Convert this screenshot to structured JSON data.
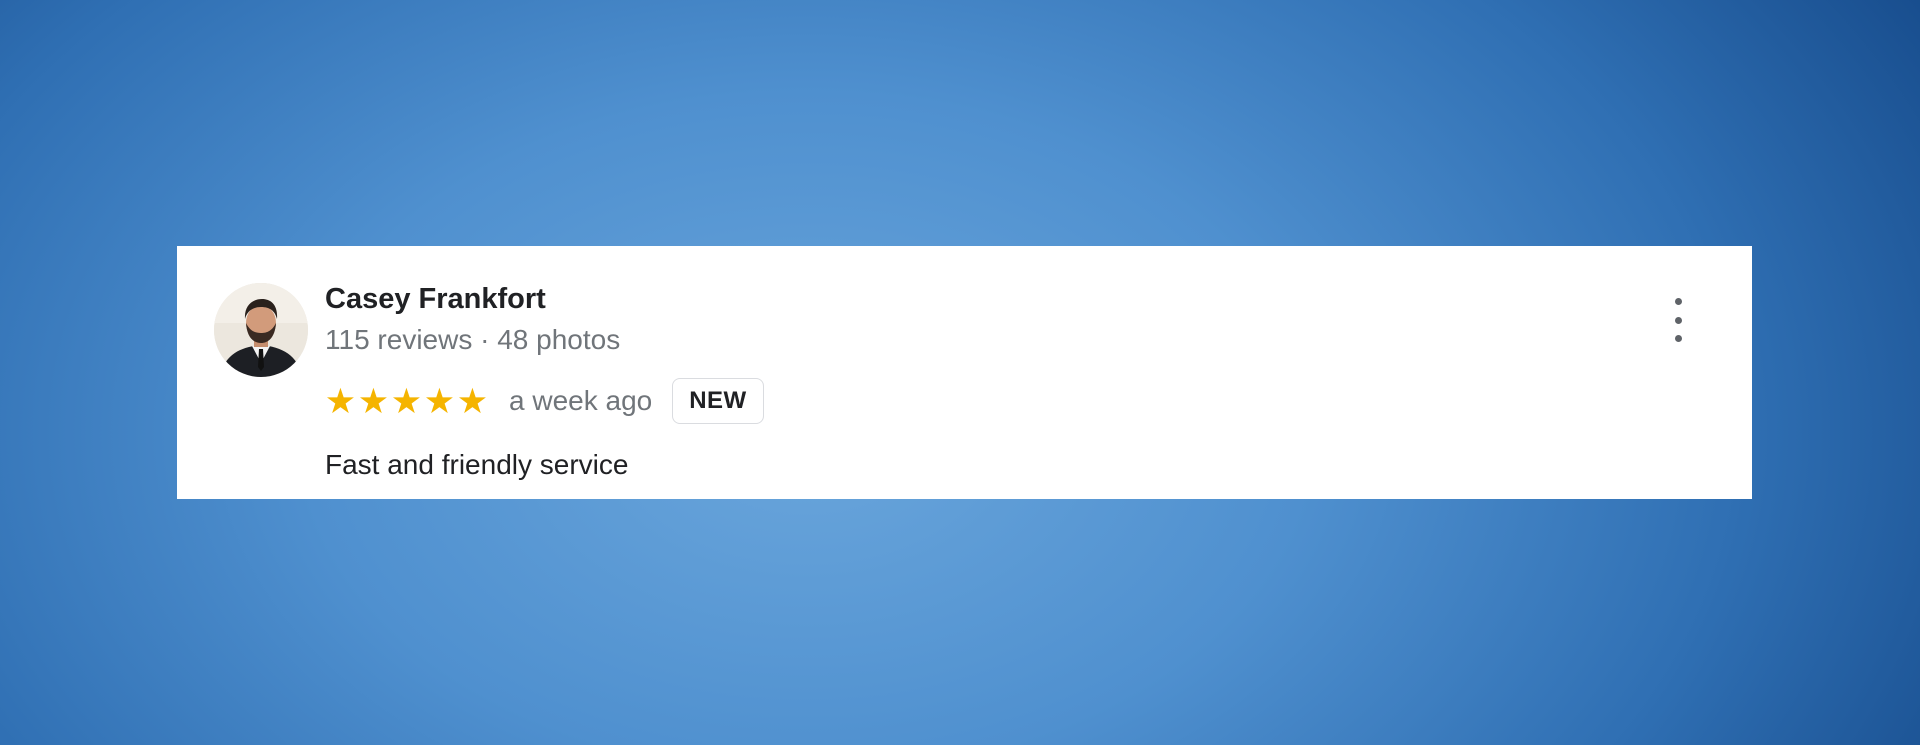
{
  "review": {
    "author_name": "Casey Frankfort",
    "author_meta": "115 reviews · 48 photos",
    "rating": 5,
    "star_glyph": "★",
    "star_color": "#f5b400",
    "time_ago": "a week ago",
    "badge": "NEW",
    "text": "Fast and friendly service",
    "more_icon": "more-vert-icon"
  }
}
